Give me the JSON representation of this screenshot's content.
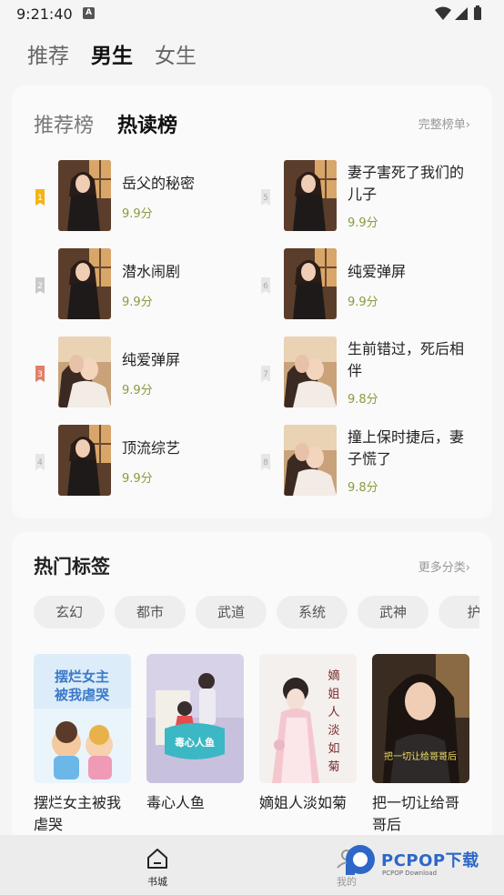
{
  "status": {
    "time": "9:21:40",
    "badge": "A"
  },
  "top_tabs": [
    "推荐",
    "男生",
    "女生"
  ],
  "top_active": 1,
  "ranking": {
    "tabs": [
      "推荐榜",
      "热读榜"
    ],
    "active": 1,
    "more": "完整榜单",
    "books": [
      {
        "rank": "1",
        "title": "岳父的秘密",
        "score": "9.9分",
        "cover": "dress"
      },
      {
        "rank": "2",
        "title": "潜水闹剧",
        "score": "9.9分",
        "cover": "dress"
      },
      {
        "rank": "3",
        "title": "纯爱弹屏",
        "score": "9.9分",
        "cover": "couple"
      },
      {
        "rank": "4",
        "title": "顶流综艺",
        "score": "9.9分",
        "cover": "dress"
      },
      {
        "rank": "5",
        "title": "妻子害死了我们的儿子",
        "score": "9.9分",
        "cover": "dress"
      },
      {
        "rank": "6",
        "title": "纯爱弹屏",
        "score": "9.9分",
        "cover": "dress"
      },
      {
        "rank": "7",
        "title": "生前错过，死后相伴",
        "score": "9.8分",
        "cover": "couple"
      },
      {
        "rank": "8",
        "title": "撞上保时捷后，妻子慌了",
        "score": "9.8分",
        "cover": "couple"
      }
    ]
  },
  "hot_tags": {
    "title": "热门标签",
    "more": "更多分类",
    "tags": [
      "玄幻",
      "都市",
      "武道",
      "系统",
      "武神",
      "护"
    ]
  },
  "hot_books": [
    {
      "title": "摆烂女主被我虐哭",
      "cover_text": "摆烂女主被我虐哭"
    },
    {
      "title": "毒心人鱼",
      "cover_text": "毒心人鱼"
    },
    {
      "title": "嫡姐人淡如菊",
      "cover_text": "嫡姐人淡如菊"
    },
    {
      "title": "把一切让给哥哥后",
      "cover_text": "把一切让给哥哥后"
    }
  ],
  "bottom_nav": [
    {
      "label": "书城",
      "icon": "home-icon"
    },
    {
      "label": "我的",
      "icon": "user-icon"
    }
  ],
  "watermark": {
    "text": "PCPOP下载",
    "sub": "PCPOP Download"
  },
  "colors": {
    "score": "#8c9a3e",
    "rank_gold": "#f2b417",
    "rank_silver": "#c9c9c9",
    "rank_bronze": "#e07f6a",
    "watermark": "#2d67c8"
  }
}
